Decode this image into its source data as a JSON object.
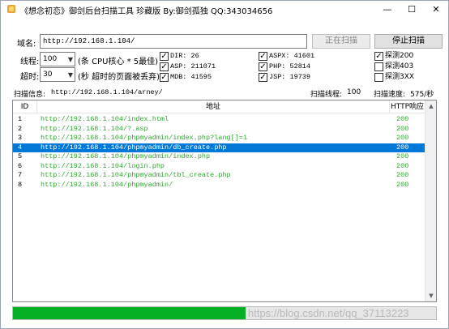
{
  "window": {
    "title": "《想念初恋》御剑后台扫描工具 珍藏版 By:御剑孤独 QQ:343034656",
    "minimize": "—",
    "maximize": "☐",
    "close": "✕"
  },
  "form": {
    "domain_label": "域名:",
    "domain_value": "http://192.168.1.104/",
    "threads_label": "线程:",
    "threads_value": "100",
    "threads_hint": "(条 CPU核心 * 5最佳)",
    "timeout_label": "超时:",
    "timeout_value": "30",
    "timeout_hint": "(秒 超时的页面被丢弃)",
    "scanning_button": "正在扫描",
    "stop_button": "停止扫描"
  },
  "dictionaries": [
    {
      "label": "DIR: 26",
      "checked": true
    },
    {
      "label": "ASP: 211071",
      "checked": true
    },
    {
      "label": "MDB: 41595",
      "checked": true
    },
    {
      "label": "ASPX: 41601",
      "checked": true
    },
    {
      "label": "PHP: 52814",
      "checked": true
    },
    {
      "label": "JSP: 19739",
      "checked": true
    }
  ],
  "probes": [
    {
      "label": "探测200",
      "checked": true
    },
    {
      "label": "探测403",
      "checked": false
    },
    {
      "label": "探测3XX",
      "checked": false
    }
  ],
  "status": {
    "info_label": "扫描信息:",
    "info_value": "http://192.168.1.104/arney/",
    "threads_label": "扫描线程:",
    "threads_value": "100",
    "speed_label": "扫描速度:",
    "speed_value": "575/秒"
  },
  "table": {
    "columns": [
      "ID",
      "地址",
      "HTTP响应"
    ],
    "selected_row": 3,
    "rows": [
      {
        "id": "1",
        "url": "http://192.168.1.104/index.html",
        "code": "200"
      },
      {
        "id": "2",
        "url": "http://192.168.1.104/?.asp",
        "code": "200"
      },
      {
        "id": "3",
        "url": "http://192.168.1.104/phpmyadmin/index.php?lang[]=1",
        "code": "200"
      },
      {
        "id": "4",
        "url": "http://192.168.1.104/phpmyadmin/db_create.php",
        "code": "200"
      },
      {
        "id": "5",
        "url": "http://192.168.1.104/phpmyadmin/index.php",
        "code": "200"
      },
      {
        "id": "6",
        "url": "http://192.168.1.104/login.php",
        "code": "200"
      },
      {
        "id": "7",
        "url": "http://192.168.1.104/phpmyadmin/tbl_create.php",
        "code": "200"
      },
      {
        "id": "8",
        "url": "http://192.168.1.104/phpmyadmin/",
        "code": "200"
      }
    ]
  },
  "progress": {
    "fraction": 0.55
  },
  "watermark": "https://blog.csdn.net/qq_37113223",
  "colors": {
    "accent": "#0078d7",
    "ok_green": "#2faa2f",
    "progress": "#06b025"
  }
}
